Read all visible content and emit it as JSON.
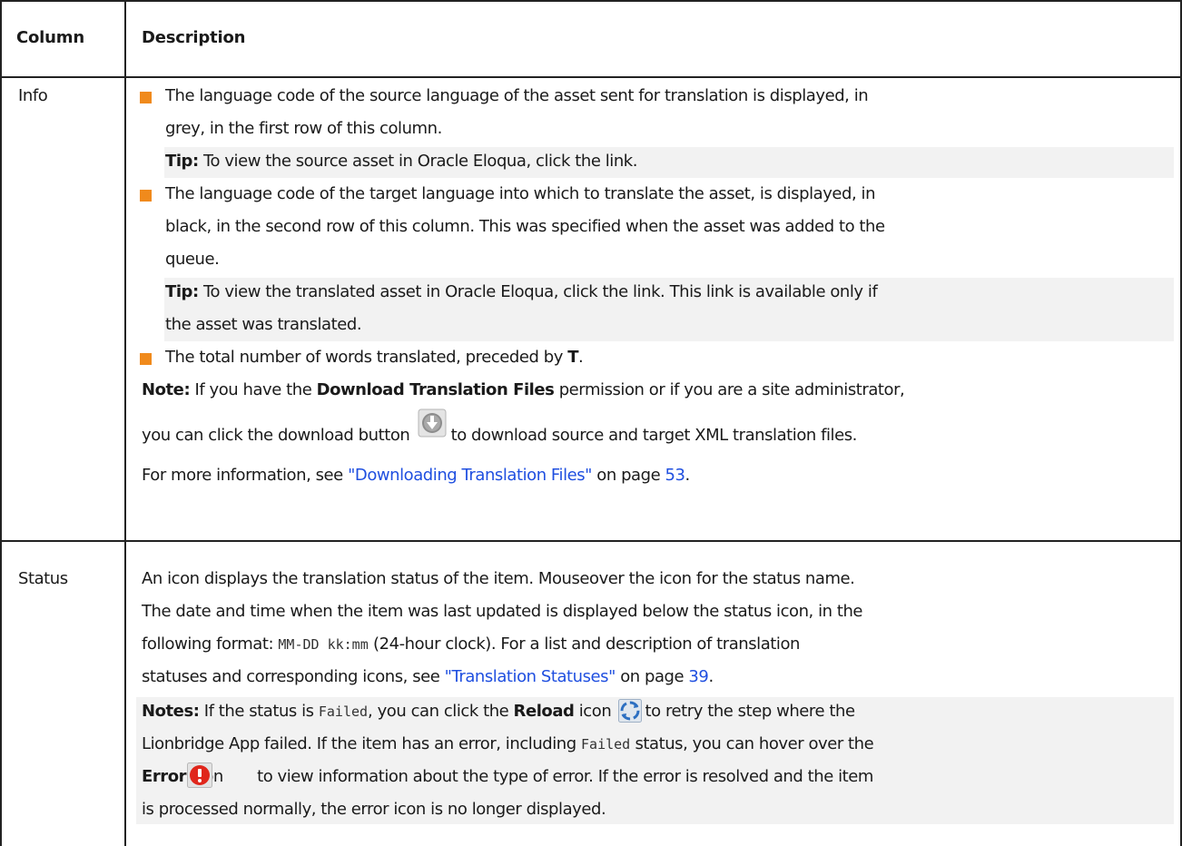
{
  "header": {
    "col1": "Column",
    "col2": "Description"
  },
  "info": {
    "label": "Info",
    "b1": {
      "l1": "The language code of the source language of the asset sent for translation is displayed, in",
      "l2": "grey, in the first row of this column.",
      "tip_label": "Tip:",
      "tip_text": " To view the source asset in Oracle Eloqua, click the link."
    },
    "b2": {
      "l1": "The language code of the target language into which to translate the asset, is displayed, in",
      "l2": "black, in the second row of this column. This was specified when the asset was added to the",
      "l3": "queue.",
      "tip_label": "Tip:",
      "tip_l1": " To view the translated asset in Oracle Eloqua, click the link. This link is available only if",
      "tip_l2": "the asset was translated."
    },
    "b3": {
      "text": "The total number of words translated, preceded by ",
      "bold": "T",
      "end": "."
    },
    "note": {
      "label": "Note:",
      "p1": " If you have the ",
      "perm": "Download Translation Files",
      "p2": " permission or if you are a site administrator,",
      "p3": "you can click the download button",
      "p4": " to download source and target XML translation files.",
      "p5": "For more information, see ",
      "link": "\"Downloading Translation Files\"",
      "p6": " on page ",
      "page": "53",
      "p7": "."
    }
  },
  "status": {
    "label": "Status",
    "l1": "An icon displays the translation status of the item. Mouseover the icon for the status name.",
    "l2": "The date and time when the item was last updated is displayed below the status icon, in the",
    "l3a": "following format: ",
    "l3code": "MM-DD kk:mm",
    "l3b": " (24-hour clock). For a list and description of translation",
    "l4a": "statuses and corresponding icons, see ",
    "l4link": "\"Translation Statuses\"",
    "l4b": " on page ",
    "l4page": "39",
    "l4c": ".",
    "notes_label": "Notes:",
    "n1a": " If the status is ",
    "n1code": "Failed",
    "n1b": ", you can click the ",
    "n1bold": "Reload",
    "n1c": " icon",
    "n1d": " to retry the step where the",
    "n2a": "Lionbridge App failed. If the item has an error, including ",
    "n2code": "Failed",
    "n2b": " status, you can hover over the",
    "n3bold": "Error",
    "n3a": " icon",
    "n3b": "  to view information about the type of error. If the error is resolved and the item",
    "n4": "is processed normally, the error icon is no longer displayed."
  },
  "colors": {
    "bullet": "#f08a1c",
    "link": "#1f4fe0",
    "tip_bg": "#f2f2f2"
  },
  "icons": [
    "download-icon",
    "reload-icon",
    "error-icon"
  ]
}
